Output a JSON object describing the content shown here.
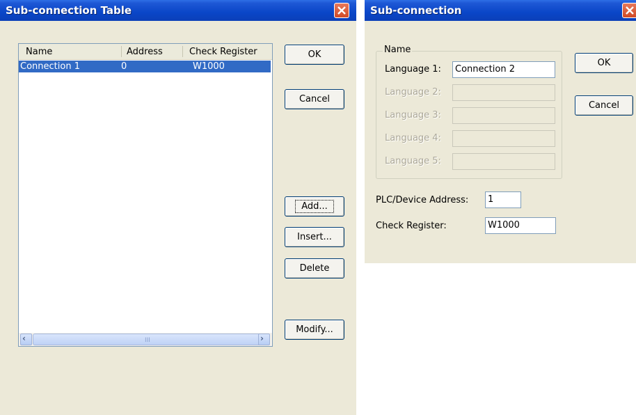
{
  "table_dialog": {
    "title": "Sub-connection Table",
    "columns": [
      "Name",
      "Address",
      "Check Register"
    ],
    "rows": [
      {
        "name": "Connection 1",
        "address": "0",
        "check_register": "W1000"
      }
    ],
    "buttons": {
      "ok": "OK",
      "cancel": "Cancel",
      "add": "Add...",
      "insert": "Insert...",
      "delete": "Delete",
      "modify": "Modify..."
    },
    "scroll_grip": "III"
  },
  "sub_dialog": {
    "title": "Sub-connection",
    "group_label": "Name",
    "language_fields": [
      {
        "label": "Language 1:",
        "value": "Connection 2",
        "enabled": true
      },
      {
        "label": "Language 2:",
        "value": "",
        "enabled": false
      },
      {
        "label": "Language 3:",
        "value": "",
        "enabled": false
      },
      {
        "label": "Language 4:",
        "value": "",
        "enabled": false
      },
      {
        "label": "Language 5:",
        "value": "",
        "enabled": false
      }
    ],
    "plc_address_label": "PLC/Device Address:",
    "plc_address_value": "1",
    "check_register_label": "Check Register:",
    "check_register_value": "W1000",
    "buttons": {
      "ok": "OK",
      "cancel": "Cancel"
    }
  },
  "colors": {
    "titlebar": "#0A46C8",
    "dialog_bg": "#ECE9D8",
    "selection": "#316AC5",
    "close_button": "#D14A25"
  },
  "icons": {
    "close": "close-x-icon",
    "scroll_left": "scroll-left-arrow-icon",
    "scroll_right": "scroll-right-arrow-icon"
  }
}
